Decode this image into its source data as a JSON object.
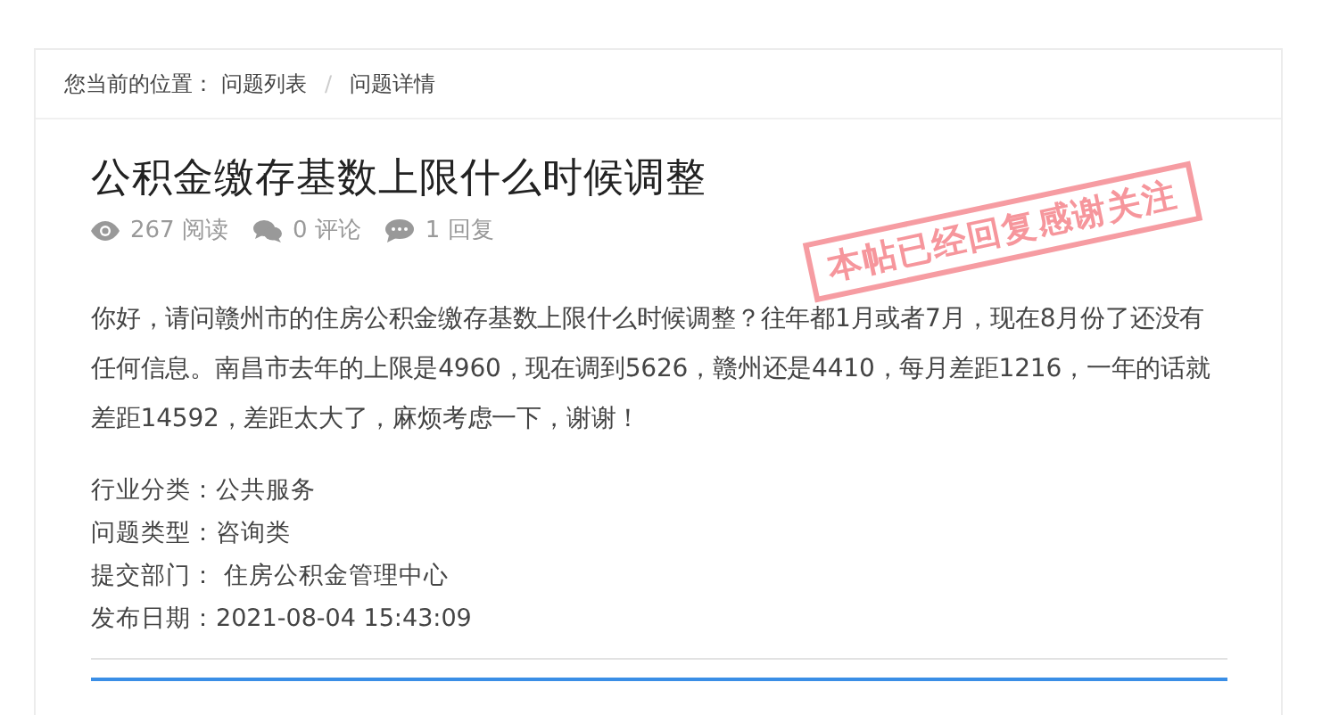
{
  "breadcrumb": {
    "label": "您当前的位置：",
    "items": [
      "问题列表",
      "问题详情"
    ],
    "separator": "/"
  },
  "title": "公积金缴存基数上限什么时候调整",
  "stats": [
    {
      "kind": "views",
      "count": "267",
      "label": "阅读"
    },
    {
      "kind": "comments",
      "count": "0",
      "label": "评论"
    },
    {
      "kind": "replies",
      "count": "1",
      "label": "回复"
    }
  ],
  "body": "你好，请问赣州市的住房公积金缴存基数上限什么时候调整？往年都1月或者7月，现在8月份了还没有任何信息。南昌市去年的上限是4960，现在调到5626，赣州还是4410，每月差距1216，一年的话就差距14592，差距太大了，麻烦考虑一下，谢谢！",
  "stamp": "本帖已经回复感谢关注",
  "meta": [
    {
      "label": "行业分类：",
      "value": "公共服务"
    },
    {
      "label": "问题类型：",
      "value": "咨询类"
    },
    {
      "label": "提交部门：",
      "value": " 住房公积金管理中心"
    },
    {
      "label": "发布日期：",
      "value": "2021-08-04 15:43:09"
    }
  ]
}
